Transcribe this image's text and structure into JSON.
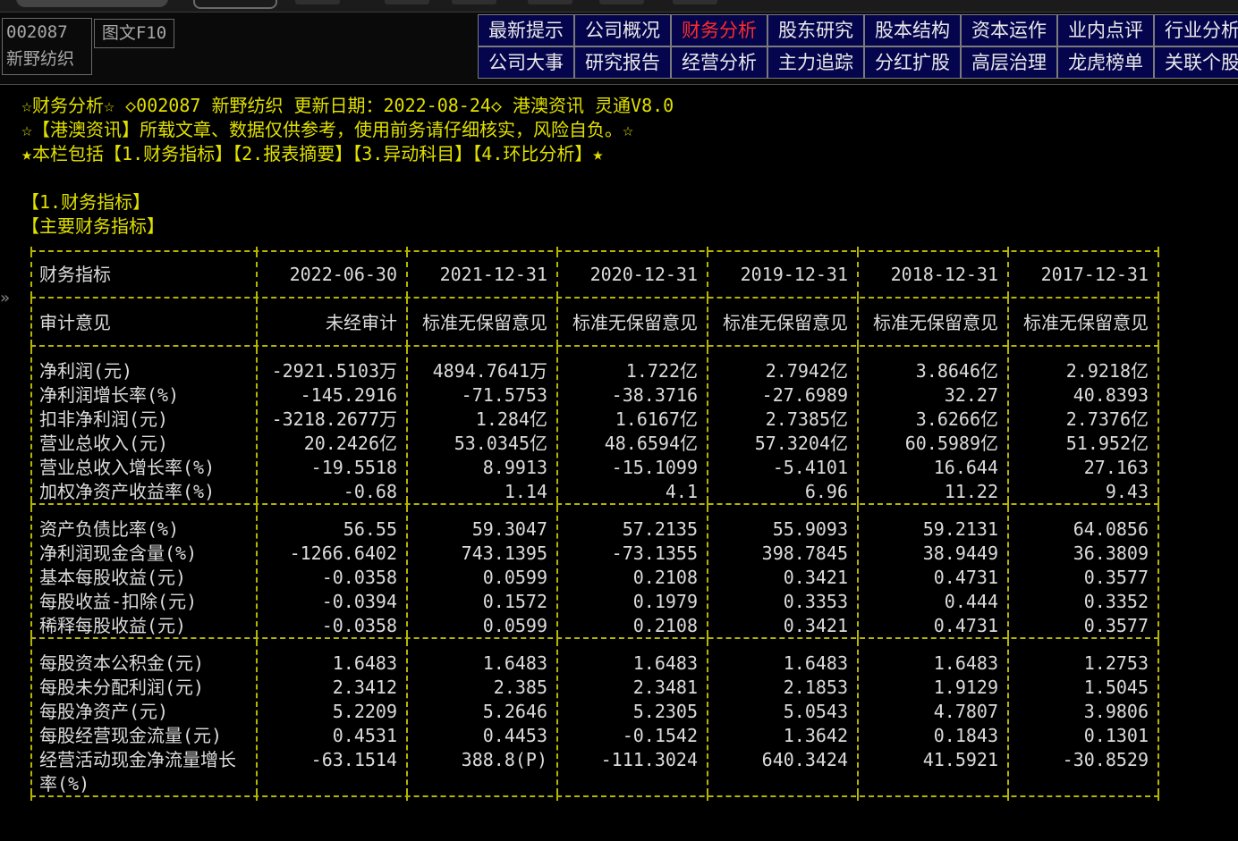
{
  "stock": {
    "code": "002087",
    "name": "新野纺织",
    "f10_button": "图文F10"
  },
  "nav": {
    "row1": [
      "最新提示",
      "公司概况",
      "财务分析",
      "股东研究",
      "股本结构",
      "资本运作",
      "业内点评",
      "行业分析"
    ],
    "row2": [
      "公司大事",
      "研究报告",
      "经营分析",
      "主力追踪",
      "分红扩股",
      "高层治理",
      "龙虎榜单",
      "关联个股"
    ],
    "active": "财务分析"
  },
  "side_arrow": "»",
  "intro": {
    "line1": "☆财务分析☆ ◇002087 新野纺织 更新日期：2022-08-24◇ 港澳资讯 灵通V8.0",
    "line2": "☆【港澳资讯】所载文章、数据仅供参考，使用前务请仔细核实，风险自负。☆",
    "line3": "★本栏包括【1.财务指标】【2.报表摘要】【3.异动科目】【4.环比分析】★"
  },
  "section": {
    "title": "【1.财务指标】",
    "subtitle": "【主要财务指标】"
  },
  "table": {
    "header_label": "财务指标",
    "columns": [
      "2022-06-30",
      "2021-12-31",
      "2020-12-31",
      "2019-12-31",
      "2018-12-31",
      "2017-12-31"
    ],
    "audit": {
      "label": "审计意见",
      "values": [
        "未经审计",
        "标准无保留意见",
        "标准无保留意见",
        "标准无保留意见",
        "标准无保留意见",
        "标准无保留意见"
      ]
    },
    "groups": [
      [
        {
          "label": "净利润(元)",
          "values": [
            "-2921.5103万",
            "4894.7641万",
            "1.722亿",
            "2.7942亿",
            "3.8646亿",
            "2.9218亿"
          ]
        },
        {
          "label": "净利润增长率(%)",
          "values": [
            "-145.2916",
            "-71.5753",
            "-38.3716",
            "-27.6989",
            "32.27",
            "40.8393"
          ]
        },
        {
          "label": "扣非净利润(元)",
          "values": [
            "-3218.2677万",
            "1.284亿",
            "1.6167亿",
            "2.7385亿",
            "3.6266亿",
            "2.7376亿"
          ]
        },
        {
          "label": "营业总收入(元)",
          "values": [
            "20.2426亿",
            "53.0345亿",
            "48.6594亿",
            "57.3204亿",
            "60.5989亿",
            "51.952亿"
          ]
        },
        {
          "label": "营业总收入增长率(%)",
          "values": [
            "-19.5518",
            "8.9913",
            "-15.1099",
            "-5.4101",
            "16.644",
            "27.163"
          ]
        },
        {
          "label": "加权净资产收益率(%)",
          "values": [
            "-0.68",
            "1.14",
            "4.1",
            "6.96",
            "11.22",
            "9.43"
          ]
        }
      ],
      [
        {
          "label": "资产负债比率(%)",
          "values": [
            "56.55",
            "59.3047",
            "57.2135",
            "55.9093",
            "59.2131",
            "64.0856"
          ]
        },
        {
          "label": "净利润现金含量(%)",
          "values": [
            "-1266.6402",
            "743.1395",
            "-73.1355",
            "398.7845",
            "38.9449",
            "36.3809"
          ]
        },
        {
          "label": "基本每股收益(元)",
          "values": [
            "-0.0358",
            "0.0599",
            "0.2108",
            "0.3421",
            "0.4731",
            "0.3577"
          ]
        },
        {
          "label": "每股收益-扣除(元)",
          "values": [
            "-0.0394",
            "0.1572",
            "0.1979",
            "0.3353",
            "0.444",
            "0.3352"
          ]
        },
        {
          "label": "稀释每股收益(元)",
          "values": [
            "-0.0358",
            "0.0599",
            "0.2108",
            "0.3421",
            "0.4731",
            "0.3577"
          ]
        }
      ],
      [
        {
          "label": "每股资本公积金(元)",
          "values": [
            "1.6483",
            "1.6483",
            "1.6483",
            "1.6483",
            "1.6483",
            "1.2753"
          ]
        },
        {
          "label": "每股未分配利润(元)",
          "values": [
            "2.3412",
            "2.385",
            "2.3481",
            "2.1853",
            "1.9129",
            "1.5045"
          ]
        },
        {
          "label": "每股净资产(元)",
          "values": [
            "5.2209",
            "5.2646",
            "5.2305",
            "5.0543",
            "4.7807",
            "3.9806"
          ]
        },
        {
          "label": "每股经营现金流量(元)",
          "values": [
            "0.4531",
            "0.4453",
            "-0.1542",
            "1.3642",
            "0.1843",
            "0.1301"
          ]
        },
        {
          "label": "经营活动现金净流量增长",
          "values": [
            "-63.1514",
            "388.8(P)",
            "-111.3024",
            "640.3424",
            "41.5921",
            "-30.8529"
          ]
        },
        {
          "label": "率(%)",
          "values": [
            "",
            "",
            "",
            "",
            "",
            ""
          ]
        }
      ]
    ]
  }
}
